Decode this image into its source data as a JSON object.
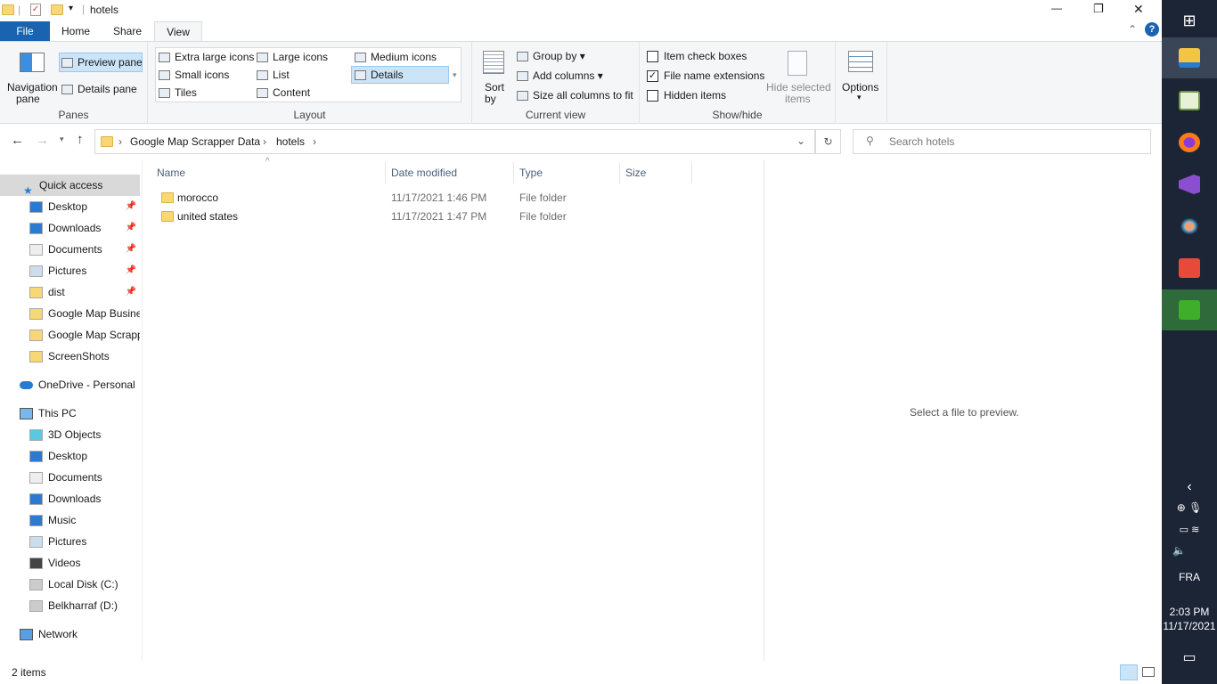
{
  "window": {
    "title": "hotels",
    "controls": {
      "minimize": "—",
      "maximize": "❐",
      "close": "✕"
    }
  },
  "tabs": {
    "file": "File",
    "home": "Home",
    "share": "Share",
    "view": "View"
  },
  "ribbon": {
    "panes": {
      "navigation": "Navigation",
      "navigation2": "pane",
      "preview": "Preview pane",
      "details": "Details pane",
      "label": "Panes"
    },
    "layout": {
      "items": [
        "Extra large icons",
        "Large icons",
        "Medium icons",
        "Small icons",
        "List",
        "Details",
        "Tiles",
        "Content"
      ],
      "label": "Layout"
    },
    "current_view": {
      "sort": "Sort",
      "sort2": "by",
      "group": "Group by",
      "add_columns": "Add columns",
      "size_all": "Size all columns to fit",
      "label": "Current view"
    },
    "show_hide": {
      "item_check": "Item check boxes",
      "extensions": "File name extensions",
      "hidden": "Hidden items",
      "hide_selected": "Hide selected",
      "hide_selected2": "items",
      "label": "Show/hide",
      "item_check_checked": false,
      "extensions_checked": true,
      "hidden_checked": false
    },
    "options": "Options"
  },
  "address": {
    "crumbs": [
      "Google Map Scrapper Data",
      "hotels"
    ],
    "search_placeholder": "Search hotels"
  },
  "nav": {
    "quick_access": "Quick access",
    "quick": [
      {
        "label": "Desktop",
        "pin": true
      },
      {
        "label": "Downloads",
        "pin": true
      },
      {
        "label": "Documents",
        "pin": true
      },
      {
        "label": "Pictures",
        "pin": true
      },
      {
        "label": "dist",
        "pin": true
      },
      {
        "label": "Google Map Busine"
      },
      {
        "label": "Google Map Scrapp"
      },
      {
        "label": "ScreenShots"
      }
    ],
    "onedrive": "OneDrive - Personal",
    "this_pc": "This PC",
    "pc": [
      "3D Objects",
      "Desktop",
      "Documents",
      "Downloads",
      "Music",
      "Pictures",
      "Videos",
      "Local Disk (C:)",
      "Belkharraf (D:)"
    ],
    "network": "Network"
  },
  "columns": {
    "name": "Name",
    "date": "Date modified",
    "type": "Type",
    "size": "Size"
  },
  "files": [
    {
      "name": "morocco",
      "date": "11/17/2021 1:46 PM",
      "type": "File folder"
    },
    {
      "name": "united states",
      "date": "11/17/2021 1:47 PM",
      "type": "File folder"
    }
  ],
  "preview": "Select a file to preview.",
  "status": "2 items",
  "taskbar": {
    "lang": "FRA",
    "time": "2:03 PM",
    "date": "11/17/2021"
  }
}
